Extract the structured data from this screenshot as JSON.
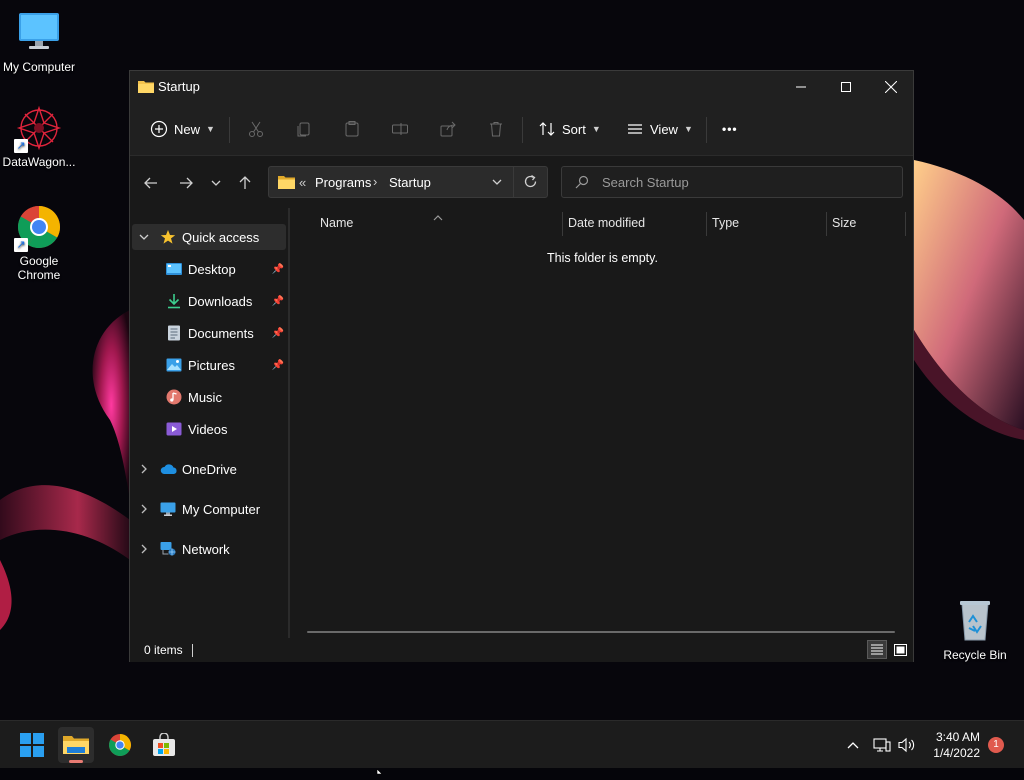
{
  "desktop": {
    "icons": [
      {
        "label": "My Computer"
      },
      {
        "label": "DataWagon..."
      },
      {
        "label": "Google Chrome"
      },
      {
        "label": "Recycle Bin"
      }
    ]
  },
  "window": {
    "title": "Startup",
    "toolbar": {
      "new_label": "New",
      "sort_label": "Sort",
      "view_label": "View",
      "more_label": "•••"
    },
    "address": {
      "overflow": "«",
      "crumbs": [
        "Programs",
        "Startup"
      ],
      "separator": "›"
    },
    "search": {
      "placeholder": "Search Startup"
    },
    "sidebar": {
      "quick_access": "Quick access",
      "items": [
        {
          "label": "Desktop",
          "pinned": true
        },
        {
          "label": "Downloads",
          "pinned": true
        },
        {
          "label": "Documents",
          "pinned": true
        },
        {
          "label": "Pictures",
          "pinned": true
        },
        {
          "label": "Music",
          "pinned": false
        },
        {
          "label": "Videos",
          "pinned": false
        }
      ],
      "roots": [
        {
          "label": "OneDrive"
        },
        {
          "label": "My Computer"
        },
        {
          "label": "Network"
        }
      ]
    },
    "columns": [
      "Name",
      "Date modified",
      "Type",
      "Size"
    ],
    "empty_message": "This folder is empty.",
    "status": "0 items"
  },
  "taskbar": {
    "time": "3:40 AM",
    "date": "1/4/2022",
    "notification_count": "1"
  },
  "colors": {
    "accent": "#0078d4",
    "folder": "#f4c34d",
    "window_bg": "#191919"
  }
}
